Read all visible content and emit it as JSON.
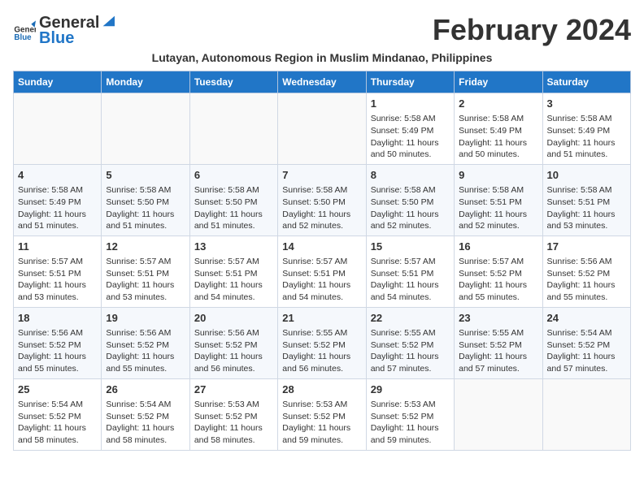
{
  "header": {
    "logo_general": "General",
    "logo_blue": "Blue",
    "month_title": "February 2024",
    "subtitle": "Lutayan, Autonomous Region in Muslim Mindanao, Philippines"
  },
  "calendar": {
    "days_of_week": [
      "Sunday",
      "Monday",
      "Tuesday",
      "Wednesday",
      "Thursday",
      "Friday",
      "Saturday"
    ],
    "weeks": [
      [
        {
          "day": "",
          "info": ""
        },
        {
          "day": "",
          "info": ""
        },
        {
          "day": "",
          "info": ""
        },
        {
          "day": "",
          "info": ""
        },
        {
          "day": "1",
          "info": "Sunrise: 5:58 AM\nSunset: 5:49 PM\nDaylight: 11 hours and 50 minutes."
        },
        {
          "day": "2",
          "info": "Sunrise: 5:58 AM\nSunset: 5:49 PM\nDaylight: 11 hours and 50 minutes."
        },
        {
          "day": "3",
          "info": "Sunrise: 5:58 AM\nSunset: 5:49 PM\nDaylight: 11 hours and 51 minutes."
        }
      ],
      [
        {
          "day": "4",
          "info": "Sunrise: 5:58 AM\nSunset: 5:49 PM\nDaylight: 11 hours and 51 minutes."
        },
        {
          "day": "5",
          "info": "Sunrise: 5:58 AM\nSunset: 5:50 PM\nDaylight: 11 hours and 51 minutes."
        },
        {
          "day": "6",
          "info": "Sunrise: 5:58 AM\nSunset: 5:50 PM\nDaylight: 11 hours and 51 minutes."
        },
        {
          "day": "7",
          "info": "Sunrise: 5:58 AM\nSunset: 5:50 PM\nDaylight: 11 hours and 52 minutes."
        },
        {
          "day": "8",
          "info": "Sunrise: 5:58 AM\nSunset: 5:50 PM\nDaylight: 11 hours and 52 minutes."
        },
        {
          "day": "9",
          "info": "Sunrise: 5:58 AM\nSunset: 5:51 PM\nDaylight: 11 hours and 52 minutes."
        },
        {
          "day": "10",
          "info": "Sunrise: 5:58 AM\nSunset: 5:51 PM\nDaylight: 11 hours and 53 minutes."
        }
      ],
      [
        {
          "day": "11",
          "info": "Sunrise: 5:57 AM\nSunset: 5:51 PM\nDaylight: 11 hours and 53 minutes."
        },
        {
          "day": "12",
          "info": "Sunrise: 5:57 AM\nSunset: 5:51 PM\nDaylight: 11 hours and 53 minutes."
        },
        {
          "day": "13",
          "info": "Sunrise: 5:57 AM\nSunset: 5:51 PM\nDaylight: 11 hours and 54 minutes."
        },
        {
          "day": "14",
          "info": "Sunrise: 5:57 AM\nSunset: 5:51 PM\nDaylight: 11 hours and 54 minutes."
        },
        {
          "day": "15",
          "info": "Sunrise: 5:57 AM\nSunset: 5:51 PM\nDaylight: 11 hours and 54 minutes."
        },
        {
          "day": "16",
          "info": "Sunrise: 5:57 AM\nSunset: 5:52 PM\nDaylight: 11 hours and 55 minutes."
        },
        {
          "day": "17",
          "info": "Sunrise: 5:56 AM\nSunset: 5:52 PM\nDaylight: 11 hours and 55 minutes."
        }
      ],
      [
        {
          "day": "18",
          "info": "Sunrise: 5:56 AM\nSunset: 5:52 PM\nDaylight: 11 hours and 55 minutes."
        },
        {
          "day": "19",
          "info": "Sunrise: 5:56 AM\nSunset: 5:52 PM\nDaylight: 11 hours and 55 minutes."
        },
        {
          "day": "20",
          "info": "Sunrise: 5:56 AM\nSunset: 5:52 PM\nDaylight: 11 hours and 56 minutes."
        },
        {
          "day": "21",
          "info": "Sunrise: 5:55 AM\nSunset: 5:52 PM\nDaylight: 11 hours and 56 minutes."
        },
        {
          "day": "22",
          "info": "Sunrise: 5:55 AM\nSunset: 5:52 PM\nDaylight: 11 hours and 57 minutes."
        },
        {
          "day": "23",
          "info": "Sunrise: 5:55 AM\nSunset: 5:52 PM\nDaylight: 11 hours and 57 minutes."
        },
        {
          "day": "24",
          "info": "Sunrise: 5:54 AM\nSunset: 5:52 PM\nDaylight: 11 hours and 57 minutes."
        }
      ],
      [
        {
          "day": "25",
          "info": "Sunrise: 5:54 AM\nSunset: 5:52 PM\nDaylight: 11 hours and 58 minutes."
        },
        {
          "day": "26",
          "info": "Sunrise: 5:54 AM\nSunset: 5:52 PM\nDaylight: 11 hours and 58 minutes."
        },
        {
          "day": "27",
          "info": "Sunrise: 5:53 AM\nSunset: 5:52 PM\nDaylight: 11 hours and 58 minutes."
        },
        {
          "day": "28",
          "info": "Sunrise: 5:53 AM\nSunset: 5:52 PM\nDaylight: 11 hours and 59 minutes."
        },
        {
          "day": "29",
          "info": "Sunrise: 5:53 AM\nSunset: 5:52 PM\nDaylight: 11 hours and 59 minutes."
        },
        {
          "day": "",
          "info": ""
        },
        {
          "day": "",
          "info": ""
        }
      ]
    ]
  }
}
